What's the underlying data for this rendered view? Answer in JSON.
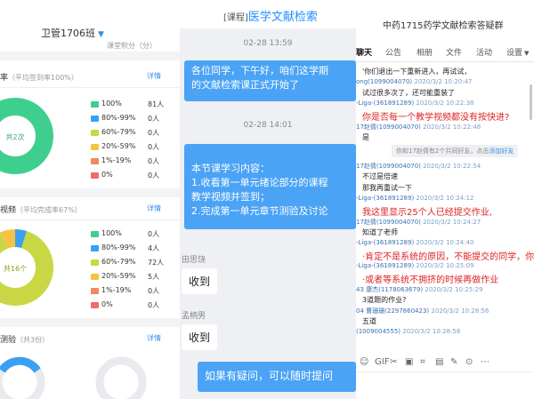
{
  "left": {
    "class_name": "卫管1706班",
    "score_hint": "课堂积分（分）",
    "detail_label": "详情",
    "sec1": {
      "title": "率",
      "sub": "（平均签到率100%）",
      "center": "共2次"
    },
    "sec2": {
      "title": "视频",
      "sub": "（平均完成率67%）",
      "center": "共16个"
    },
    "sec3": {
      "title": "测验",
      "sub": "（共3份）"
    },
    "legend1": [
      {
        "label": "100%",
        "count": "81人",
        "color": "#3ecf8e"
      },
      {
        "label": "80%-99%",
        "count": "0人",
        "color": "#3aa0f2"
      },
      {
        "label": "60%-79%",
        "count": "0人",
        "color": "#c9d744"
      },
      {
        "label": "20%-59%",
        "count": "0人",
        "color": "#f5c342"
      },
      {
        "label": "1%-19%",
        "count": "0人",
        "color": "#f08a5d"
      },
      {
        "label": "0%",
        "count": "0人",
        "color": "#f26a6a"
      }
    ],
    "legend2": [
      {
        "label": "100%",
        "count": "0人",
        "color": "#3ecf8e"
      },
      {
        "label": "80%-99%",
        "count": "4人",
        "color": "#3aa0f2"
      },
      {
        "label": "60%-79%",
        "count": "72人",
        "color": "#c9d744"
      },
      {
        "label": "20%-59%",
        "count": "5人",
        "color": "#f5c342"
      },
      {
        "label": "1%-19%",
        "count": "0人",
        "color": "#f08a5d"
      },
      {
        "label": "0%",
        "count": "0人",
        "color": "#f26a6a"
      }
    ]
  },
  "middle": {
    "tag": "[课程]",
    "title": "医学文献检索",
    "ts1": "02-28 13:59",
    "msg1": [
      "各位同学，下午好，咱们这学期",
      "的文献检索课正式开始了"
    ],
    "ts2": "02-28 14:01",
    "msg2": [
      "本节课学习内容：",
      "1.收看第一单元绪论部分的课程",
      "教学视频并签到；",
      "2.完成第一单元章节测验及讨论"
    ],
    "sender1": "田思饶",
    "reply1": "收到",
    "sender2": "孟柄男",
    "reply2": "收到",
    "msg3": "如果有疑问，可以随时提问"
  },
  "right": {
    "title": "中药1715药学文献检索答疑群",
    "tabs": [
      "聊天",
      "公告",
      "相册",
      "文件",
      "活动",
      "设置"
    ],
    "msgs": [
      {
        "kind": "text",
        "text": "'你们退出一下重新进入，再试试，"
      },
      {
        "kind": "meta",
        "name": "ong(1099004070)",
        "date": "2020/3/2 10:20:47"
      },
      {
        "kind": "text",
        "text": "试过很多次了，还可能重装了"
      },
      {
        "kind": "meta",
        "name": "-Liga-(361891289)",
        "date": "2020/3/2 10:22:38"
      },
      {
        "kind": "red",
        "text": "你是否每一个教学视频都没有按快进?"
      },
      {
        "kind": "meta",
        "name": "17赵倩(1099004070)",
        "date": "2020/3/2 10:22:48"
      },
      {
        "kind": "text",
        "text": "是"
      },
      {
        "kind": "sys",
        "text": "你和17赵倩有2个共同好友，点击",
        "link": "添加好友"
      },
      {
        "kind": "meta",
        "name": "17赵倩(1099004070)",
        "date": "2020/3/2 10:22:54"
      },
      {
        "kind": "text",
        "text": "不过是倍速"
      },
      {
        "kind": "text",
        "text": "那我再重试一下"
      },
      {
        "kind": "meta",
        "name": "-Liga-(361891289)",
        "date": "2020/3/2 10:24:12"
      },
      {
        "kind": "red",
        "text": "我这里显示25个人已经提交作业,"
      },
      {
        "kind": "meta",
        "name": "17赵倩(1099004070)",
        "date": "2020/3/2 10:24:27"
      },
      {
        "kind": "text",
        "text": "知道了老师"
      },
      {
        "kind": "meta",
        "name": "-Liga-(361891289)",
        "date": "2020/3/2 10:24:40"
      },
      {
        "kind": "red",
        "text": "·肯定不是系统的原因，不能提交的同学，你们用"
      },
      {
        "kind": "meta",
        "name": "-Liga-(361891289)",
        "date": "2020/3/2 10:25:09"
      },
      {
        "kind": "red",
        "text": "·或者等系统不拥挤的时候再做作业"
      },
      {
        "kind": "meta",
        "name": "43  康杰(1178063679)",
        "date": "2020/3/2 10:25:29"
      },
      {
        "kind": "text",
        "text": "3道题的作业?"
      },
      {
        "kind": "meta",
        "name": "04 曹珊珊(2297860423)",
        "date": "2020/3/2 10:28:56"
      },
      {
        "kind": "text",
        "text": "五道"
      },
      {
        "kind": "meta",
        "name": "(1009004555)",
        "date": "2020/3/2 10:28:58"
      }
    ],
    "toolbar": [
      "☺",
      "GIF",
      "✂",
      "▣",
      "⌗",
      "▤",
      "✎",
      "⊙",
      "⋯"
    ]
  }
}
